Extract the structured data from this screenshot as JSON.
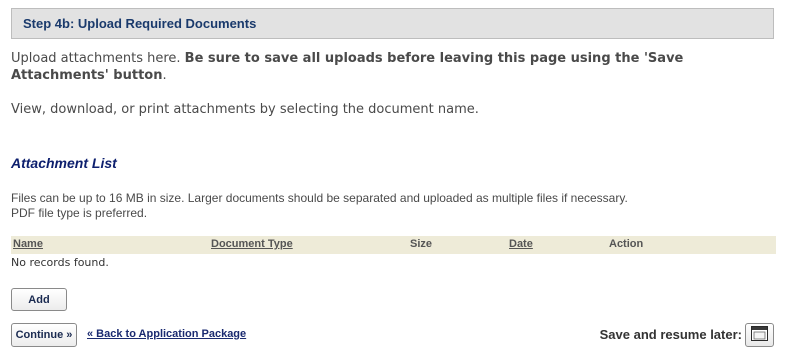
{
  "step_header": {
    "title": "Step 4b: Upload Required Documents"
  },
  "intro": {
    "plain": "Upload attachments here. ",
    "bold": "Be sure to save all uploads before leaving this page using the 'Save Attachments' button",
    "end": "."
  },
  "view_text": "View, download, or print attachments by selecting the document name.",
  "attachment_list": {
    "title": "Attachment List",
    "note_line1": "Files can be up to 16 MB in size. Larger documents should be separated and uploaded as multiple files if necessary.",
    "note_line2": "PDF file type is preferred.",
    "columns": {
      "name": "Name",
      "document_type": "Document Type",
      "size": "Size",
      "date": "Date",
      "action": "Action"
    },
    "empty_message": "No records found."
  },
  "buttons": {
    "add": "Add",
    "continue": "Continue »",
    "back_link": "« Back to Application Package",
    "save_resume_label": "Save and resume later:"
  },
  "icons": {
    "save": "save-icon"
  },
  "colors": {
    "header_bg": "#e2e2e2",
    "header_text": "#1a3a6c",
    "section_title": "#0d1f6e",
    "table_header_bg": "#eeebd8"
  }
}
